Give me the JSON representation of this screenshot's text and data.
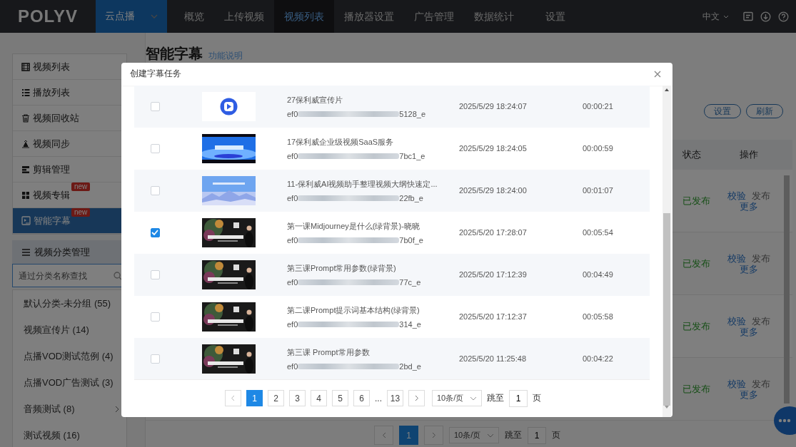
{
  "nav": {
    "logo": "POLYV",
    "product": "云点播",
    "items": [
      {
        "label": "概览",
        "selected": false
      },
      {
        "label": "上传视频",
        "selected": false
      },
      {
        "label": "视频列表",
        "selected": true
      },
      {
        "label": "播放器设置",
        "selected": false
      },
      {
        "label": "广告管理",
        "selected": false
      },
      {
        "label": "数据统计",
        "selected": false
      },
      {
        "label": "设置",
        "selected": false
      }
    ],
    "language": "中文"
  },
  "sidebar": {
    "items": [
      {
        "label": "视频列表",
        "selected": false
      },
      {
        "label": "播放列表",
        "selected": false
      },
      {
        "label": "视频回收站",
        "selected": false
      },
      {
        "label": "视频同步",
        "selected": false
      },
      {
        "label": "剪辑管理",
        "selected": false
      },
      {
        "label": "视频专辑",
        "selected": false,
        "badge": "new"
      },
      {
        "label": "智能字幕",
        "selected": true,
        "badge": "new"
      }
    ],
    "category": {
      "title": "视频分类管理",
      "placeholder": "通过分类名称查找",
      "items": [
        {
          "label": "默认分类-未分组 (55)",
          "expandable": false
        },
        {
          "label": "视频宣传片 (14)",
          "expandable": false
        },
        {
          "label": "点播VOD测试范例 (4)",
          "expandable": false
        },
        {
          "label": "点播VOD广告测试 (3)",
          "expandable": false
        },
        {
          "label": "音频测试 (8)",
          "expandable": true
        },
        {
          "label": "测试视频 (16)",
          "expandable": false
        }
      ]
    }
  },
  "page": {
    "title": "智能字幕",
    "help_link": "功能说明",
    "buttons": [
      "设置",
      "刷新"
    ],
    "table": {
      "columns": [
        "状态",
        "操作"
      ],
      "rows": [
        {
          "status": "已发布",
          "actions": [
            {
              "label": "校验",
              "disabled": false
            },
            {
              "label": "发布",
              "disabled": true
            },
            {
              "label": "更多",
              "disabled": false
            }
          ]
        },
        {
          "status": "已发布",
          "actions": [
            {
              "label": "校验",
              "disabled": false
            },
            {
              "label": "发布",
              "disabled": true
            },
            {
              "label": "更多",
              "disabled": false
            }
          ]
        },
        {
          "status": "已发布",
          "actions": [
            {
              "label": "校验",
              "disabled": false
            },
            {
              "label": "发布",
              "disabled": true
            },
            {
              "label": "更多",
              "disabled": false
            }
          ]
        },
        {
          "status": "已发布",
          "actions": [
            {
              "label": "校验",
              "disabled": false
            },
            {
              "label": "发布",
              "disabled": true
            },
            {
              "label": "更多",
              "disabled": false
            }
          ]
        }
      ]
    },
    "pagination": {
      "pages": [
        {
          "label": "1",
          "selected": true
        }
      ],
      "page_size": "10条/页",
      "jump_label": "跳至",
      "jump_value": "1",
      "page_unit": "页"
    }
  },
  "dialog": {
    "title": "创建字幕任务",
    "rows": [
      {
        "checked": false,
        "kind": "logo",
        "title": "27保利威宣传片",
        "id_start": "ef0",
        "id_end": "5128_e",
        "date": "2025/5/29 18:24:07",
        "duration": "00:00:21"
      },
      {
        "checked": false,
        "kind": "picture",
        "title": "17保利威企业级视频SaaS服务",
        "id_start": "ef0",
        "id_end": "7bc1_e",
        "date": "2025/5/29 18:24:05",
        "duration": "00:00:59"
      },
      {
        "checked": false,
        "kind": "picture",
        "title": "11-保利威AI视频助手整理视频大纲快速定...",
        "id_start": "ef0",
        "id_end": "22fb_e",
        "date": "2025/5/29 18:24:00",
        "duration": "00:01:07"
      },
      {
        "checked": true,
        "kind": "picture",
        "title": "第一课Midjourney是什么(绿背景)-晓晓",
        "id_start": "ef0",
        "id_end": "7b0f_e",
        "date": "2025/5/20 17:28:07",
        "duration": "00:05:54"
      },
      {
        "checked": false,
        "kind": "picture",
        "title": "第三课Prompt常用参数(绿背景)",
        "id_start": "ef0",
        "id_end": "77c_e",
        "date": "2025/5/20 17:12:39",
        "duration": "00:04:49"
      },
      {
        "checked": false,
        "kind": "picture",
        "title": "第二课Prompt提示词基本结构(绿背景)",
        "id_start": "ef0",
        "id_end": "314_e",
        "date": "2025/5/20 17:12:37",
        "duration": "00:05:58"
      },
      {
        "checked": false,
        "kind": "picture",
        "title": "第三课 Prompt常用参数",
        "id_start": "ef0",
        "id_end": "2bd_e",
        "date": "2025/5/20 11:25:48",
        "duration": "00:04:22"
      }
    ],
    "pagination": {
      "pages": [
        {
          "kind": "page",
          "label": "1",
          "selected": true
        },
        {
          "kind": "page",
          "label": "2",
          "selected": false
        },
        {
          "kind": "page",
          "label": "3",
          "selected": false
        },
        {
          "kind": "page",
          "label": "4",
          "selected": false
        },
        {
          "kind": "page",
          "label": "5",
          "selected": false
        },
        {
          "kind": "page",
          "label": "6",
          "selected": false
        },
        {
          "kind": "ellipsis",
          "label": "..."
        },
        {
          "kind": "page",
          "label": "13",
          "selected": false
        }
      ],
      "page_size": "10条/页",
      "jump_label": "跳至",
      "jump_value": "1",
      "page_unit": "页"
    }
  }
}
